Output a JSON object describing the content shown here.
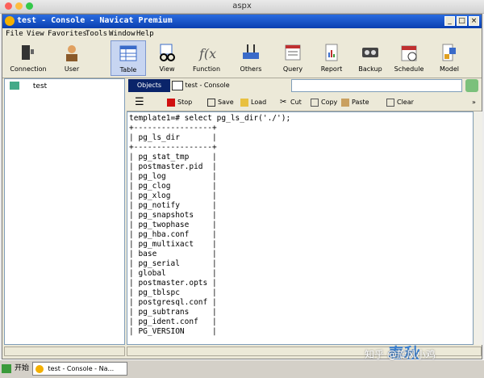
{
  "mac_window": {
    "title": "aspx"
  },
  "window": {
    "title": "test - Console - Navicat Premium"
  },
  "menu": [
    "File",
    "View",
    "Favorites",
    "Tools",
    "Window",
    "Help"
  ],
  "toolbar": [
    "Connection",
    "User",
    "Table",
    "View",
    "Function",
    "Others",
    "Query",
    "Report",
    "Backup",
    "Schedule",
    "Model"
  ],
  "sidebar": {
    "items": [
      "test"
    ]
  },
  "tabs": {
    "objects": "Objects",
    "console": "test - Console"
  },
  "console_toolbar": {
    "stop": "Stop",
    "save": "Save",
    "load": "Load",
    "cut": "Cut",
    "copy": "Copy",
    "paste": "Paste",
    "clear": "Clear"
  },
  "console": {
    "lines": [
      "template1=# select pg_ls_dir('./');",
      "+-----------------+",
      "| pg_ls_dir       |",
      "+-----------------+",
      "| pg_stat_tmp     |",
      "| postmaster.pid  |",
      "| pg_log          |",
      "| pg_clog         |",
      "| pg_xlog         |",
      "| pg_notify       |",
      "| pg_snapshots    |",
      "| pg_twophase     |",
      "| pg_hba.conf     |",
      "| pg_multixact    |",
      "| base            |",
      "| pg_serial       |",
      "| global          |",
      "| postmaster.opts |",
      "| pg_tblspc       |",
      "| postgresql.conf |",
      "| pg_subtrans     |",
      "| pg_ident.conf   |",
      "| PG_VERSION      |"
    ]
  },
  "taskbar": {
    "start": "开始",
    "item": "test - Console - Na..."
  },
  "watermark": {
    "text": "知乎 @旋风小鸡",
    "logo": "春秋"
  }
}
